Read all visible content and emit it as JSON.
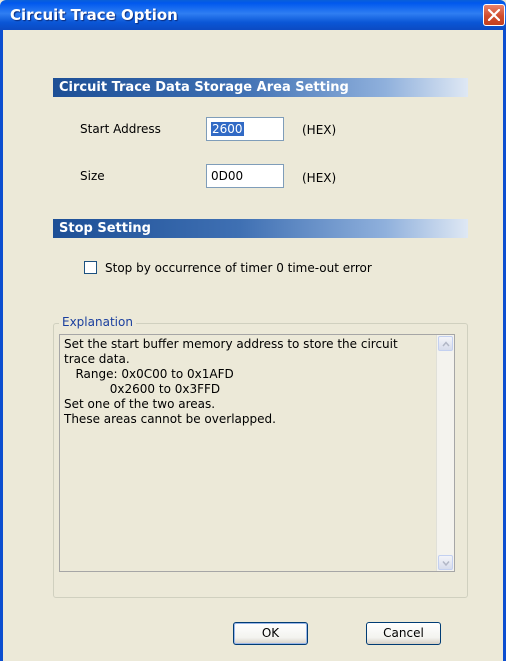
{
  "window": {
    "title": "Circuit Trace Option"
  },
  "storage_section": {
    "header": "Circuit Trace Data Storage Area Setting",
    "start_address_label": "Start Address",
    "start_address_value": "2600",
    "size_label": "Size",
    "size_value": "0D00",
    "hex_suffix": "(HEX)"
  },
  "stop_section": {
    "header": "Stop Setting",
    "checkbox_label": "Stop by occurrence of timer 0 time-out error",
    "checkbox_checked": false
  },
  "explanation": {
    "legend": "Explanation",
    "text": "Set the start buffer memory address to store the circuit\ntrace data.\n   Range: 0x0C00 to 0x1AFD\n            0x2600 to 0x3FFD\nSet one of the two areas.\nThese areas cannot be overlapped."
  },
  "buttons": {
    "ok": "OK",
    "cancel": "Cancel"
  },
  "icons": {
    "close": "close-icon",
    "scroll_up": "chevron-up-icon",
    "scroll_down": "chevron-down-icon"
  },
  "colors": {
    "title_bar": "#0a56d6",
    "close_button": "#d04d2d",
    "section_header": "#1d4f96",
    "dialog_background": "#ece9d8",
    "selection": "#316ac5"
  }
}
